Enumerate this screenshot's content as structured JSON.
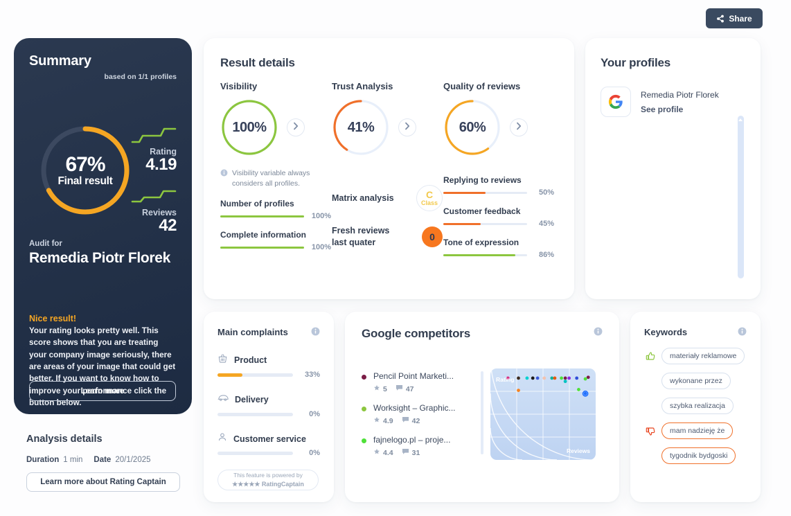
{
  "topbar": {
    "share_label": "Share",
    "share_icon": "share-icon"
  },
  "summary": {
    "title": "Summary",
    "based_on": "based on 1/1 profiles",
    "final_percent": "67%",
    "final_label": "Final result",
    "final_value": 67,
    "rating_label": "Rating",
    "rating_value": "4.19",
    "reviews_label": "Reviews",
    "reviews_value": "42",
    "audit_for_label": "Audit for",
    "audit_name": "Remedia Piotr Florek",
    "nice_title": "Nice result!",
    "nice_body": "Your rating looks pretty well. This score shows that you are treating your company image seriously, there are areas of your image that could get better. If you want to know how to improve your performance click the button below.",
    "learn_more_label": "Learn more",
    "accent_color": "#f5a623"
  },
  "analysis_details": {
    "title": "Analysis details",
    "duration_label": "Duration",
    "duration_value": "1 min",
    "date_label": "Date",
    "date_value": "20/1/2025",
    "captain_button_label": "Learn more about Rating Captain"
  },
  "result_details": {
    "title": "Result details",
    "gauges": [
      {
        "name": "Visibility",
        "percent": "100%",
        "value": 100,
        "color": "#8cc63f"
      },
      {
        "name": "Trust Analysis",
        "percent": "41%",
        "value": 41,
        "color": "#f0702a"
      },
      {
        "name": "Quality of reviews",
        "percent": "60%",
        "value": 60,
        "color": "#f5a623"
      }
    ],
    "visibility": {
      "hint": "Visibility variable always considers all profiles.",
      "metrics": [
        {
          "name": "Number of profiles",
          "percent": "100%",
          "value": 100,
          "color": "#8cc63f"
        },
        {
          "name": "Complete information",
          "percent": "100%",
          "value": 100,
          "color": "#8cc63f"
        }
      ]
    },
    "trust": {
      "matrix_label": "Matrix analysis",
      "matrix_grade": "C",
      "matrix_grade_word": "Class",
      "fresh_label": "Fresh reviews last quater",
      "fresh_value": "0"
    },
    "quality": {
      "metrics": [
        {
          "name": "Replying to reviews",
          "percent": "50%",
          "value": 50,
          "color": "#f0702a"
        },
        {
          "name": "Customer feedback",
          "percent": "45%",
          "value": 45,
          "color": "#f0702a"
        },
        {
          "name": "Tone of expression",
          "percent": "86%",
          "value": 86,
          "color": "#8cc63f"
        }
      ]
    }
  },
  "your_profiles": {
    "title": "Your profiles",
    "profiles": [
      {
        "icon": "google-icon",
        "name": "Remedia Piotr Florek",
        "link_label": "See profile"
      }
    ]
  },
  "main_complaints": {
    "title": "Main complaints",
    "info_icon": "info-icon",
    "items": [
      {
        "icon": "basket-icon",
        "name": "Product",
        "percent": "33%",
        "value": 33,
        "color": "#f5a623"
      },
      {
        "icon": "truck-icon",
        "name": "Delivery",
        "percent": "0%",
        "value": 0,
        "color": "#f5a623"
      },
      {
        "icon": "person-icon",
        "name": "Customer service",
        "percent": "0%",
        "value": 0,
        "color": "#f5a623"
      }
    ],
    "powered_line1": "This feature is powered by",
    "powered_line2": "RatingCaptain",
    "powered_stars": "★★★★★"
  },
  "google_competitors": {
    "title": "Google competitors",
    "info_icon": "info-icon",
    "items": [
      {
        "name": "Pencil Point Marketi...",
        "rating": "5",
        "reviews": "47",
        "color": "#7b1d47"
      },
      {
        "name": "Worksight – Graphic...",
        "rating": "4.9",
        "reviews": "42",
        "color": "#8cc63f"
      },
      {
        "name": "fajnelogo.pl – proje...",
        "rating": "4.4",
        "reviews": "31",
        "color": "#4fe039"
      }
    ],
    "chart_data": {
      "type": "scatter",
      "title": "",
      "xlabel": "Reviews",
      "ylabel": "Rating",
      "xlim": [
        0,
        100
      ],
      "ylim": [
        0,
        100
      ],
      "grid": true,
      "points": [
        {
          "x": 14,
          "y": 95,
          "color": "#d63384"
        },
        {
          "x": 25,
          "y": 95,
          "color": "#3d2b1f"
        },
        {
          "x": 34,
          "y": 95,
          "color": "#00d1d1"
        },
        {
          "x": 40,
          "y": 95,
          "color": "#1b1b1b"
        },
        {
          "x": 45,
          "y": 95,
          "color": "#3b5bdb"
        },
        {
          "x": 52,
          "y": 95,
          "color": "#f2c3b0"
        },
        {
          "x": 60,
          "y": 95,
          "color": "#0fb39a"
        },
        {
          "x": 63,
          "y": 95,
          "color": "#e8590c"
        },
        {
          "x": 70,
          "y": 95,
          "color": "#4fe039"
        },
        {
          "x": 74,
          "y": 95,
          "color": "#7b1d47"
        },
        {
          "x": 78,
          "y": 95,
          "color": "#8a2be2"
        },
        {
          "x": 86,
          "y": 95,
          "color": "#2f4fd8"
        },
        {
          "x": 74,
          "y": 91,
          "color": "#00c2c2"
        },
        {
          "x": 95,
          "y": 94,
          "color": "#4fe039"
        },
        {
          "x": 98,
          "y": 96,
          "color": "#7b1d47"
        },
        {
          "x": 88,
          "y": 81,
          "color": "#4fe039"
        },
        {
          "x": 25,
          "y": 80,
          "color": "#f58220"
        },
        {
          "x": 95,
          "y": 76,
          "color": "#1f6fff"
        }
      ]
    }
  },
  "keywords": {
    "title": "Keywords",
    "info_icon": "info-icon",
    "positive_icon": "thumbs-up-icon",
    "negative_icon": "thumbs-down-icon",
    "positive": [
      "materiały reklamowe",
      "wykonane przez",
      "szybka realizacja"
    ],
    "negative": [
      "mam nadzieję że",
      "tygodnik bydgoski"
    ]
  }
}
